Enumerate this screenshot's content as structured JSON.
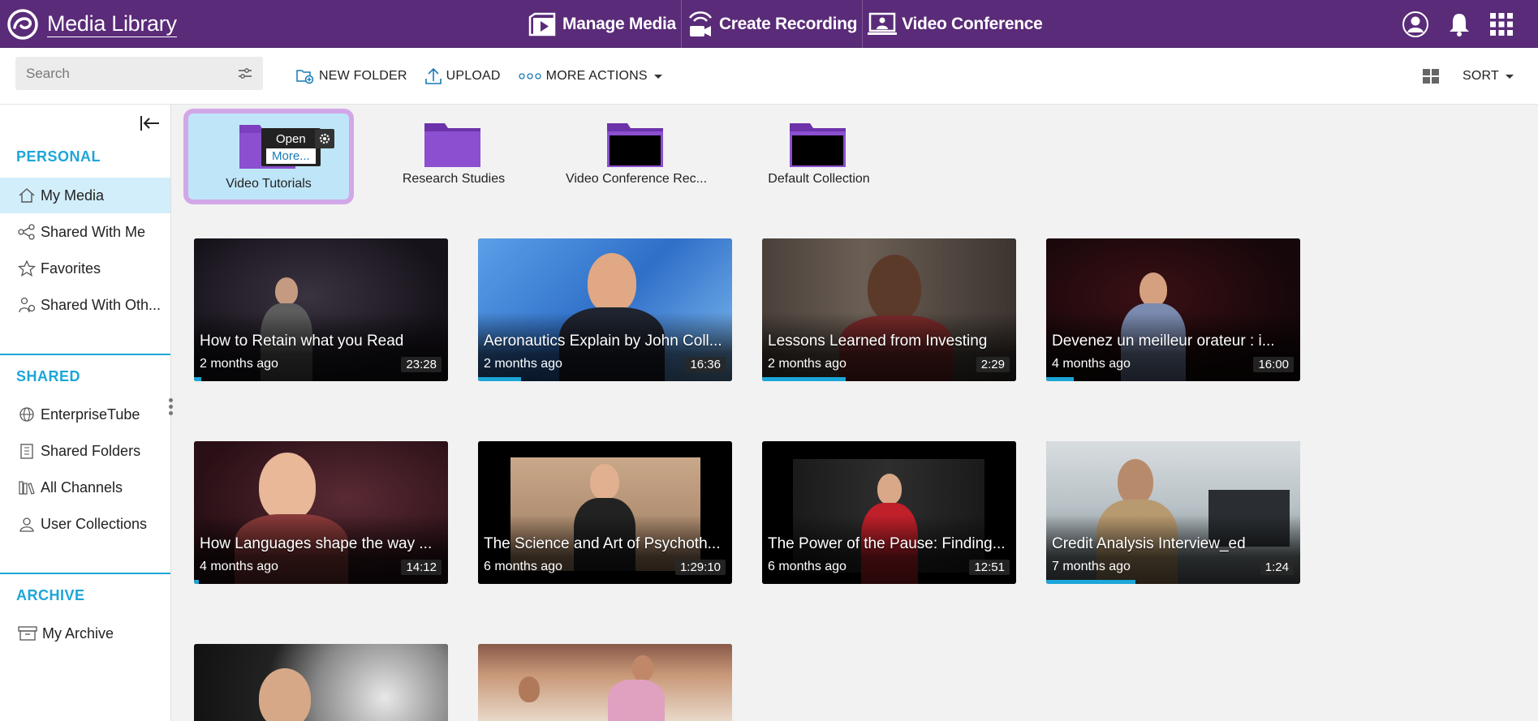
{
  "header": {
    "app_title": "Media Library",
    "nav": [
      {
        "label": "Manage Media",
        "icon": "media-play-icon"
      },
      {
        "label": "Create Recording",
        "icon": "recording-icon"
      },
      {
        "label": "Video Conference",
        "icon": "video-conference-icon"
      }
    ],
    "right_icons": [
      "user-avatar-icon",
      "bell-icon",
      "apps-grid-icon"
    ]
  },
  "toolbar": {
    "search_placeholder": "Search",
    "new_folder": "NEW FOLDER",
    "upload": "UPLOAD",
    "more_actions": "MORE ACTIONS",
    "sort": "SORT"
  },
  "sidebar": {
    "personal_title": "PERSONAL",
    "personal_items": [
      {
        "label": "My Media",
        "icon": "home-icon",
        "active": true
      },
      {
        "label": "Shared With Me",
        "icon": "share-icon"
      },
      {
        "label": "Favorites",
        "icon": "star-icon"
      },
      {
        "label": "Shared With Oth...",
        "icon": "shared-with-others-icon"
      }
    ],
    "shared_title": "SHARED",
    "shared_items": [
      {
        "label": "EnterpriseTube",
        "icon": "globe-icon"
      },
      {
        "label": "Shared Folders",
        "icon": "building-icon"
      },
      {
        "label": "All Channels",
        "icon": "library-icon"
      },
      {
        "label": "User Collections",
        "icon": "user-collection-icon"
      }
    ],
    "archive_title": "ARCHIVE",
    "archive_items": [
      {
        "label": "My Archive",
        "icon": "archive-box-icon"
      }
    ]
  },
  "folders": [
    {
      "name": "Video Tutorials",
      "selected": true
    },
    {
      "name": "Research Studies"
    },
    {
      "name": "Video Conference Rec..."
    },
    {
      "name": "Default Collection"
    }
  ],
  "folder_popover": {
    "open": "Open",
    "more": "More..."
  },
  "media": [
    {
      "title": "How to Retain what you Read",
      "date": "2 months ago",
      "duration": "23:28",
      "progress": 0.03
    },
    {
      "title": "Aeronautics Explain by John Coll...",
      "date": "2 months ago",
      "duration": "16:36",
      "progress": 0.17
    },
    {
      "title": "Lessons Learned from Investing",
      "date": "2 months ago",
      "duration": "2:29",
      "progress": 0.33
    },
    {
      "title": "Devenez un meilleur orateur : i...",
      "date": "4 months ago",
      "duration": "16:00",
      "progress": 0.11
    },
    {
      "title": "How Languages shape the way ...",
      "date": "4 months ago",
      "duration": "14:12",
      "progress": 0.02
    },
    {
      "title": "The Science and Art of Psychoth...",
      "date": "6 months ago",
      "duration": "1:29:10",
      "progress": 0
    },
    {
      "title": "The Power of the Pause: Finding...",
      "date": "6 months ago",
      "duration": "12:51",
      "progress": 0
    },
    {
      "title": "Credit Analysis Interview_ed",
      "date": "7 months ago",
      "duration": "1:24",
      "progress": 0.35
    },
    {
      "title": "",
      "date": "",
      "duration": "",
      "progress": 0
    },
    {
      "title": "",
      "date": "",
      "duration": "",
      "progress": 0
    }
  ],
  "colors": {
    "header_bg": "#5a2b78",
    "accent": "#1da6d8",
    "folder": "#7c3fbf",
    "selected_folder_bg": "#bfe6f8"
  }
}
